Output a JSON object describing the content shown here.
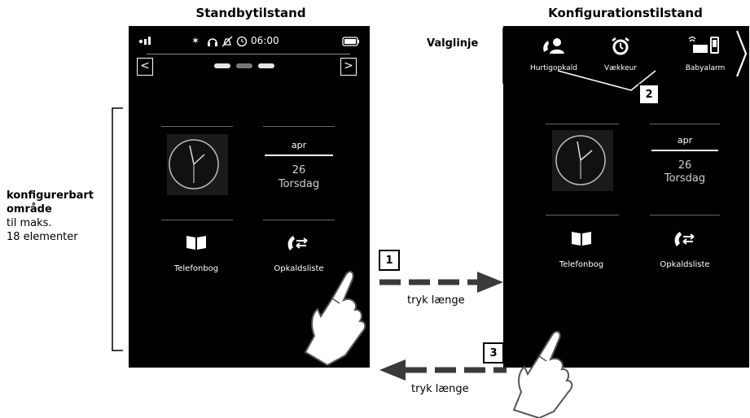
{
  "titles": {
    "left": "Standbytilstand",
    "right": "Konfigurationstilstand"
  },
  "labels": {
    "selection_line": "Valglinje",
    "configurable_area_bold_1": "konfigurerbart",
    "configurable_area_bold_2": "område",
    "configurable_area_line_3": "til maks.",
    "configurable_area_line_4": "18 elementer"
  },
  "left_phone": {
    "status_time": "06:00",
    "prev_symbol": "<",
    "next_symbol": ">",
    "date_month": "apr",
    "date_day": "26",
    "date_weekday": "Torsdag",
    "app_1_label": "Telefonbog",
    "app_2_label": "Opkaldsliste"
  },
  "right_phone": {
    "selection_items": [
      "Hurtigopkald",
      "Vækkeur",
      "Babyalarm"
    ],
    "date_month": "apr",
    "date_day": "26",
    "date_weekday": "Torsdag",
    "app_1_label": "Telefonbog",
    "app_2_label": "Opkaldsliste"
  },
  "steps": {
    "step_1": "1",
    "step_2": "2",
    "step_3": "3"
  },
  "actions": {
    "long_press_1": "tryk længe",
    "long_press_2": "tryk længe"
  },
  "colors": {
    "screen": "#000000",
    "accent_arrow": "#3a3a3a",
    "text_on_screen": "#ffffff"
  },
  "icons": [
    "signal-icon",
    "bluetooth-icon",
    "headset-icon",
    "mute-icon",
    "alarm-icon",
    "battery-icon",
    "book-icon",
    "call-list-icon",
    "quick-dial-icon",
    "alarm-clock-icon",
    "baby-monitor-icon",
    "hand-icon"
  ]
}
